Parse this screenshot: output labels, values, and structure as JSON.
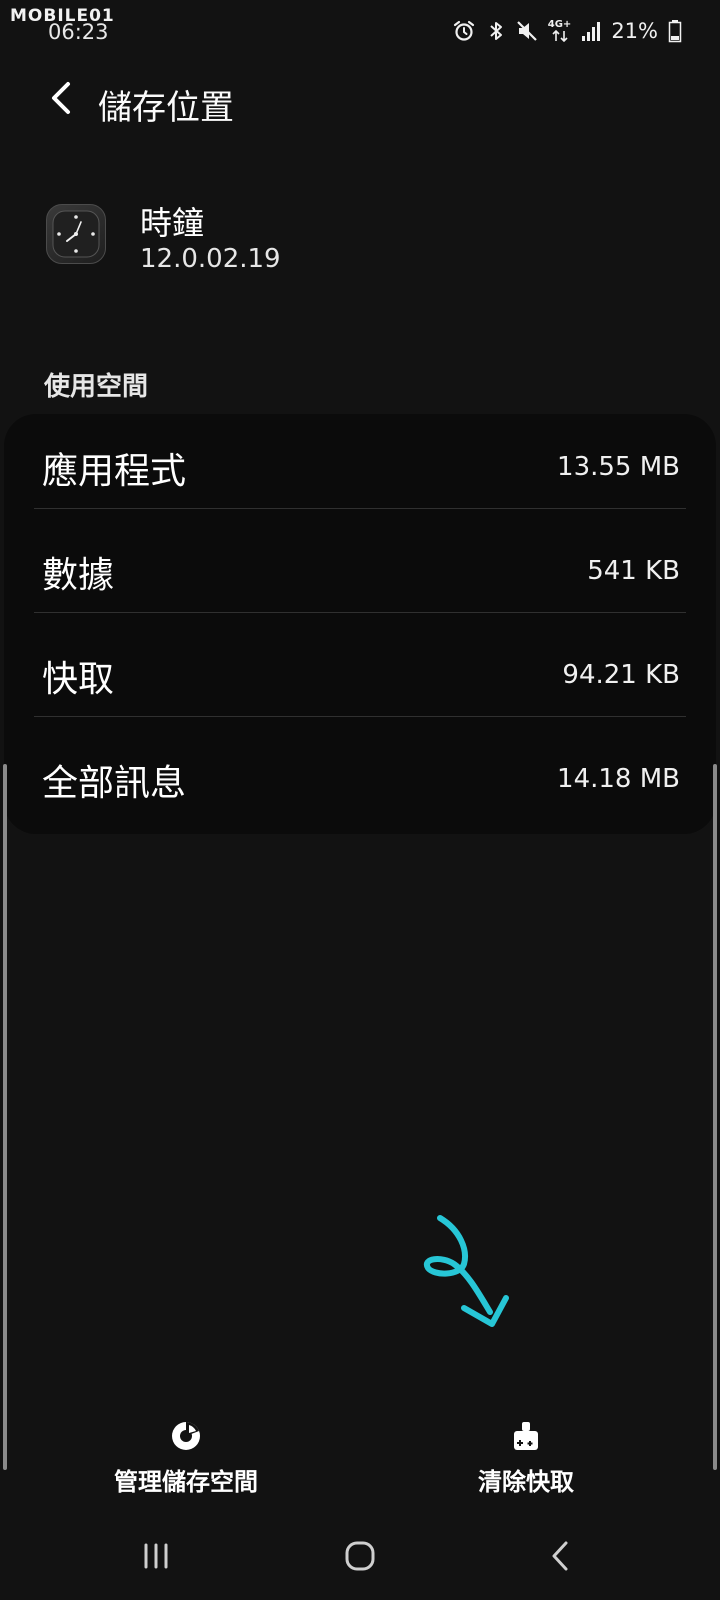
{
  "watermark": "MOBILE01",
  "status_bar": {
    "time": "06:23",
    "network": "4G+",
    "battery": "21%",
    "icons": [
      "alarm-icon",
      "bluetooth-icon",
      "mute-icon",
      "network-4g-icon",
      "signal-icon",
      "battery-icon"
    ]
  },
  "header": {
    "back_icon": "chevron-left-icon",
    "title": "儲存位置"
  },
  "app": {
    "icon": "clock-app-icon",
    "name": "時鐘",
    "version": "12.0.02.19"
  },
  "usage": {
    "section_label": "使用空間",
    "rows": [
      {
        "label": "應用程式",
        "value": "13.55 MB"
      },
      {
        "label": "數據",
        "value": "541 KB"
      },
      {
        "label": "快取",
        "value": "94.21 KB"
      },
      {
        "label": "全部訊息",
        "value": "14.18 MB"
      }
    ]
  },
  "actions": {
    "manage": {
      "icon": "pie-chart-icon",
      "label": "管理儲存空間"
    },
    "clear_cache": {
      "icon": "broom-icon",
      "label": "清除快取"
    }
  },
  "navigation": {
    "recents_icon": "recents-icon",
    "home_icon": "home-icon",
    "back_icon": "back-icon"
  },
  "colors": {
    "background": "#121212",
    "card": "#0b0b0b",
    "annotation": "#27c6d6"
  }
}
